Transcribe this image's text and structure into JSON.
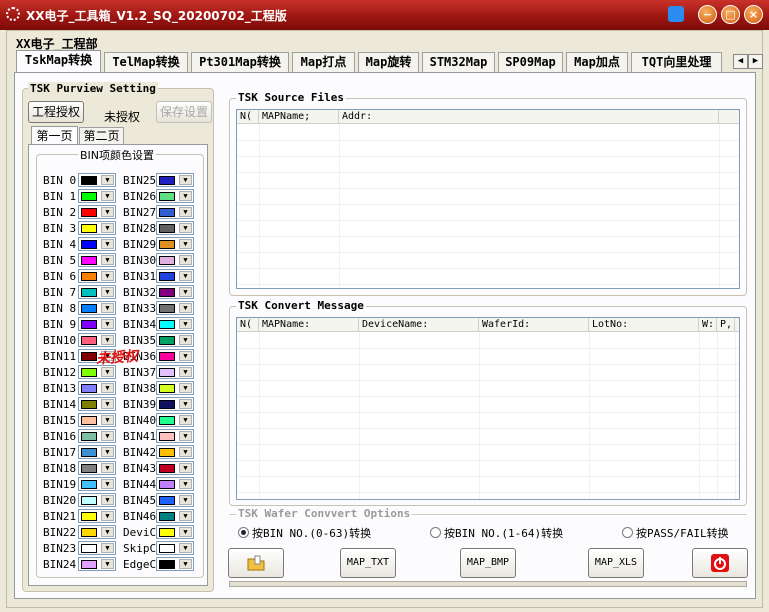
{
  "window": {
    "title": "XX电子_工具箱_V1.2_SQ_20200702_工程版",
    "buttons": {
      "minimize": "−",
      "maximize": "□",
      "close": "×"
    }
  },
  "group_label": "XX电子_工程部",
  "tabs": [
    "TskMap转换",
    "TelMap转换",
    "Pt301Map转换",
    "Map打点",
    "Map旋转",
    "STM32Map",
    "SP09Map",
    "Map加点",
    "TQT向里处理"
  ],
  "tab_scroll": {
    "left": "◀",
    "right": "▶"
  },
  "purview": {
    "title": "TSK Purview Setting",
    "auth_button": "工程授权",
    "status": "未授权",
    "save_button": "保存设置",
    "page_tabs": [
      "第一页",
      "第二页"
    ],
    "color_group": "BIN项颜色设置",
    "watermark": "未授权",
    "left_bins": [
      {
        "label": "BIN 0",
        "color": "#000000"
      },
      {
        "label": "BIN 1",
        "color": "#00ff00"
      },
      {
        "label": "BIN 2",
        "color": "#ff0000"
      },
      {
        "label": "BIN 3",
        "color": "#ffff00"
      },
      {
        "label": "BIN 4",
        "color": "#0000ff"
      },
      {
        "label": "BIN 5",
        "color": "#ff00ff"
      },
      {
        "label": "BIN 6",
        "color": "#ff8000"
      },
      {
        "label": "BIN 7",
        "color": "#00c0c0"
      },
      {
        "label": "BIN 8",
        "color": "#0080ff"
      },
      {
        "label": "BIN 9",
        "color": "#8000ff"
      },
      {
        "label": "BIN10",
        "color": "#ff6080"
      },
      {
        "label": "BIN11",
        "color": "#800000"
      },
      {
        "label": "BIN12",
        "color": "#80ff00"
      },
      {
        "label": "BIN13",
        "color": "#8080ff"
      },
      {
        "label": "BIN14",
        "color": "#808000"
      },
      {
        "label": "BIN15",
        "color": "#ffc0a0"
      },
      {
        "label": "BIN16",
        "color": "#80c0a0"
      },
      {
        "label": "BIN17",
        "color": "#4090d0"
      },
      {
        "label": "BIN18",
        "color": "#808080"
      },
      {
        "label": "BIN19",
        "color": "#40c0ff"
      },
      {
        "label": "BIN20",
        "color": "#c0ffff"
      },
      {
        "label": "BIN21",
        "color": "#ffff00"
      },
      {
        "label": "BIN22",
        "color": "#ffd700"
      },
      {
        "label": "BIN23",
        "color": "#ffffff"
      },
      {
        "label": "BIN24",
        "color": "#e0a0ff"
      }
    ],
    "right_bins": [
      {
        "label": "BIN25",
        "color": "#2020c0"
      },
      {
        "label": "BIN26",
        "color": "#60e080"
      },
      {
        "label": "BIN27",
        "color": "#3060d0"
      },
      {
        "label": "BIN28",
        "color": "#606060"
      },
      {
        "label": "BIN29",
        "color": "#e09020"
      },
      {
        "label": "BIN30",
        "color": "#e0b0e0"
      },
      {
        "label": "BIN31",
        "color": "#2040e0"
      },
      {
        "label": "BIN32",
        "color": "#800080"
      },
      {
        "label": "BIN33",
        "color": "#707070"
      },
      {
        "label": "BIN34",
        "color": "#00ffff"
      },
      {
        "label": "BIN35",
        "color": "#00a060"
      },
      {
        "label": "BIN36",
        "color": "#ff00a0"
      },
      {
        "label": "BIN37",
        "color": "#e0c0ff"
      },
      {
        "label": "BIN38",
        "color": "#d0ff20"
      },
      {
        "label": "BIN39",
        "color": "#101060"
      },
      {
        "label": "BIN40",
        "color": "#20ff90"
      },
      {
        "label": "BIN41",
        "color": "#ffc0c0"
      },
      {
        "label": "BIN42",
        "color": "#ffc000"
      },
      {
        "label": "BIN43",
        "color": "#c00020"
      },
      {
        "label": "BIN44",
        "color": "#c080ff"
      },
      {
        "label": "BIN45",
        "color": "#2060ff"
      },
      {
        "label": "BIN46",
        "color": "#008080"
      },
      {
        "label": "DeviC",
        "color": "#ffff00"
      },
      {
        "label": "SkipC",
        "color": "#ffffff"
      },
      {
        "label": "EdgeC",
        "color": "#000000"
      }
    ]
  },
  "source_files": {
    "title": "TSK Source Files",
    "columns": [
      "N(",
      "MAPName;",
      "Addr:"
    ]
  },
  "convert_message": {
    "title": "TSK Convert Message",
    "columns": [
      "N(",
      "MAPName:",
      "DeviceName:",
      "WaferId:",
      "LotNo:",
      "W:",
      "P,"
    ]
  },
  "options": {
    "title": "TSK Wafer Convvert Options",
    "radios": [
      {
        "label": "按BIN NO.(0-63)转换",
        "checked": true
      },
      {
        "label": "按BIN NO.(1-64)转换",
        "checked": false
      },
      {
        "label": "按PASS/FAIL转换",
        "checked": false
      }
    ]
  },
  "actions": {
    "open_icon": "folder-icon",
    "txt": "MAP_TXT",
    "bmp": "MAP_BMP",
    "xls": "MAP_XLS",
    "power_icon": "power-icon"
  },
  "colors": {
    "title_bar": "#9a1410",
    "power_red": "#e01010"
  }
}
